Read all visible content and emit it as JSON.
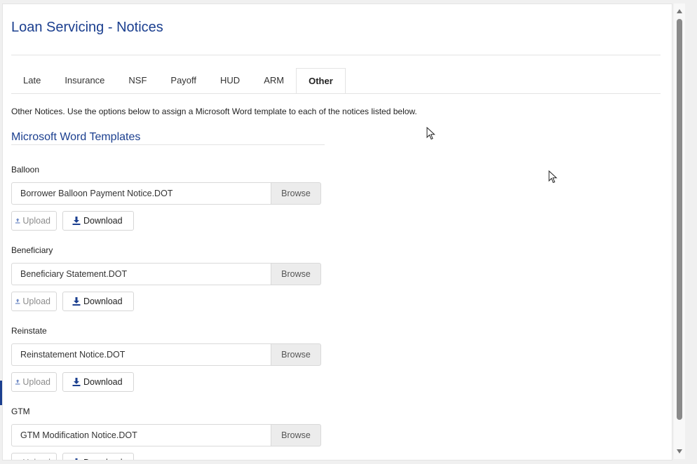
{
  "page": {
    "title": "Loan Servicing - Notices"
  },
  "tabs": [
    {
      "label": "Late",
      "active": false
    },
    {
      "label": "Insurance",
      "active": false
    },
    {
      "label": "NSF",
      "active": false
    },
    {
      "label": "Payoff",
      "active": false
    },
    {
      "label": "HUD",
      "active": false
    },
    {
      "label": "ARM",
      "active": false
    },
    {
      "label": "Other",
      "active": true
    }
  ],
  "intro": "Other Notices. Use the options below to assign a Microsoft Word template to each of the notices listed below.",
  "section": {
    "title": "Microsoft Word Templates"
  },
  "buttons": {
    "browse": "Browse",
    "upload": "Upload",
    "download": "Download"
  },
  "notices": [
    {
      "label": "Balloon",
      "file": "Borrower Balloon Payment Notice.DOT"
    },
    {
      "label": "Beneficiary",
      "file": "Beneficiary Statement.DOT"
    },
    {
      "label": "Reinstate",
      "file": "Reinstatement Notice.DOT"
    },
    {
      "label": "GTM",
      "file": "GTM Modification Notice.DOT"
    }
  ],
  "colors": {
    "accent": "#1b3f8f",
    "upload_disabled": "#8c8c8c"
  },
  "icons": {
    "upload": "upload-icon",
    "download": "download-icon"
  }
}
